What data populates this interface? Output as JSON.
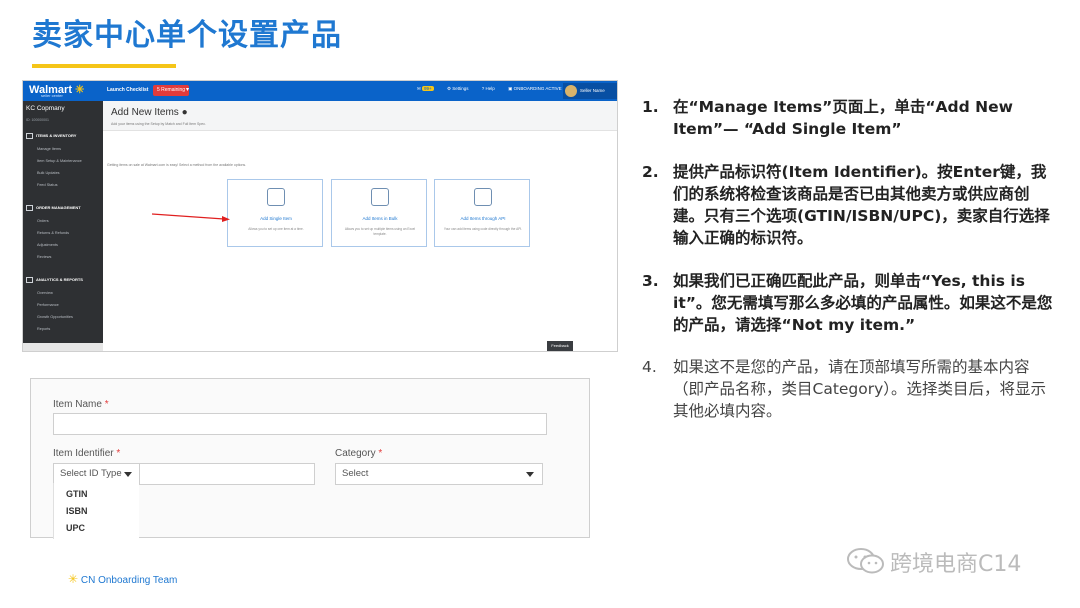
{
  "slide": {
    "title": "卖家中心单个设置产品",
    "accent_color": "#1f78d1",
    "underline_color": "#f5c518"
  },
  "walmart": {
    "logo": "Walmart",
    "logo_sub": "seller center",
    "launch_checklist": "Launch Checklist",
    "onboarding_badge": "5 Remaining",
    "top_links": [
      "Alerts",
      "Settings",
      "Help",
      "ONBOARDING ACTIVE"
    ],
    "alerts_count": "99+",
    "user_name": "Seller Name",
    "company": "KC Copmany",
    "partner_id": "ID: 100000001",
    "sections": [
      {
        "title": "ITEMS & INVENTORY",
        "items": [
          "Manage Items",
          "Item Setup & Maintenance",
          "Bulk Updates",
          "Feed Status"
        ]
      },
      {
        "title": "ORDER MANAGEMENT",
        "items": [
          "Orders",
          "Returns & Refunds",
          "Adjustments",
          "Reviews"
        ]
      },
      {
        "title": "ANALYTICS & REPORTS",
        "items": [
          "Overview",
          "Performance",
          "Growth Opportunities",
          "Reports"
        ]
      }
    ],
    "page_title": "Add New Items",
    "page_subtitle": "Add your items using the Setup by Match and Full Item Spec.",
    "help_text": "Getting items on sale at Walmart.com is easy! Select a method from the available options.",
    "cards": [
      {
        "title": "Add Single Item",
        "desc": "Allows you to set up one item at a time."
      },
      {
        "title": "Add Items in Bulk",
        "desc": "Allows you to set up multiple items using an Excel template."
      },
      {
        "title": "Add Items through API",
        "desc": "Your can add items using code directly through the API."
      }
    ],
    "feedback_label": "Feedback"
  },
  "form": {
    "item_name_label": "Item Name",
    "item_identifier_label": "Item Identifier",
    "category_label": "Category",
    "required_mark": "*",
    "id_type_placeholder": "Select ID Type",
    "category_placeholder": "Select",
    "id_options": [
      "GTIN",
      "ISBN",
      "UPC"
    ]
  },
  "steps": [
    {
      "num": "1.",
      "text": "在“Manage Items”页面上，单击“Add New Item”— “Add Single Item”"
    },
    {
      "num": "2.",
      "text": "提供产品标识符(Item Identifier)。按Enter键，我们的系统将检查该商品是否已由其他卖方或供应商创建。只有三个选项(GTIN/ISBN/UPC)，卖家自行选择输入正确的标识符。"
    },
    {
      "num": "3.",
      "text": "如果我们已正确匹配此产品，则单击“Yes, this is it”。您无需填写那么多必填的产品属性。如果这不是您的产品，请选择“Not my item.”"
    },
    {
      "num": "4.",
      "text": "如果这不是您的产品，请在顶部填写所需的基本内容（即产品名称，类目Category）。选择类目后，将显示其他必填内容。"
    }
  ],
  "footer": {
    "team": "CN Onboarding Team"
  },
  "watermark": {
    "text": "跨境电商C14"
  }
}
